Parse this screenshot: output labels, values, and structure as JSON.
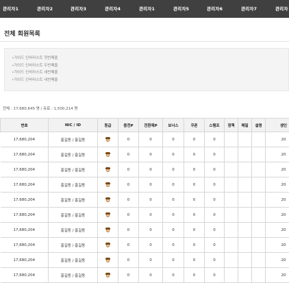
{
  "nav": {
    "items": [
      "관리자1",
      "관리자2",
      "관리자3",
      "관리자4",
      "관리자1",
      "관리자5",
      "관리자6",
      "관리자7",
      "관리자"
    ]
  },
  "page": {
    "title": "전체 회원목록",
    "info": [
      "가이드 인비라스트 첫번째줄",
      "가이드 인비라스트 두번째줄",
      "가이드 인비라스트 세번째줄",
      "가이드 인비라스트 네번째줄"
    ],
    "summary": "전체 : 17,680,645 명 / 유료 : 1,500,214 명"
  },
  "table": {
    "headers": [
      "번호",
      "NIC / ID",
      "등급",
      "충전P",
      "전환재P",
      "보너스",
      "쿠폰",
      "스탬프",
      "정책",
      "메일",
      "설명",
      "생인"
    ],
    "rows": [
      [
        "17,680,204",
        "홍길동 / 홍길동",
        "",
        "0",
        "0",
        "0",
        "0",
        "0",
        "",
        "",
        "",
        "20"
      ],
      [
        "17,680,204",
        "홍길동 / 홍길동",
        "",
        "0",
        "0",
        "0",
        "0",
        "0",
        "",
        "",
        "",
        "20"
      ],
      [
        "17,680,204",
        "홍길동 / 홍길동",
        "",
        "0",
        "0",
        "0",
        "0",
        "0",
        "",
        "",
        "",
        "20"
      ],
      [
        "17,680,204",
        "홍길동 / 홍길동",
        "",
        "0",
        "0",
        "0",
        "0",
        "0",
        "",
        "",
        "",
        "20"
      ],
      [
        "17,680,204",
        "홍길동 / 홍길동",
        "",
        "0",
        "0",
        "0",
        "0",
        "0",
        "",
        "",
        "",
        "20"
      ],
      [
        "17,680,204",
        "홍길동 / 홍길동",
        "",
        "0",
        "0",
        "0",
        "0",
        "0",
        "",
        "",
        "",
        "20"
      ],
      [
        "17,680,204",
        "홍길동 / 홍길동",
        "",
        "0",
        "0",
        "0",
        "0",
        "0",
        "",
        "",
        "",
        "20"
      ],
      [
        "17,680,204",
        "홍길동 / 홍길동",
        "",
        "0",
        "0",
        "0",
        "0",
        "0",
        "",
        "",
        "",
        "20"
      ],
      [
        "17,680,204",
        "홍길동 / 홍길동",
        "",
        "0",
        "0",
        "0",
        "0",
        "0",
        "",
        "",
        "",
        "20"
      ],
      [
        "17,680,204",
        "홍길동 / 홍길동",
        "",
        "0",
        "0",
        "0",
        "0",
        "0",
        "",
        "",
        "",
        "20"
      ]
    ],
    "grade_icon": "user-avatar-icon"
  },
  "colors": {
    "nav_bg": "#404040",
    "nav_text": "#ffffff",
    "header_bg": "#f2f2f2",
    "border": "#d6d6d6"
  }
}
